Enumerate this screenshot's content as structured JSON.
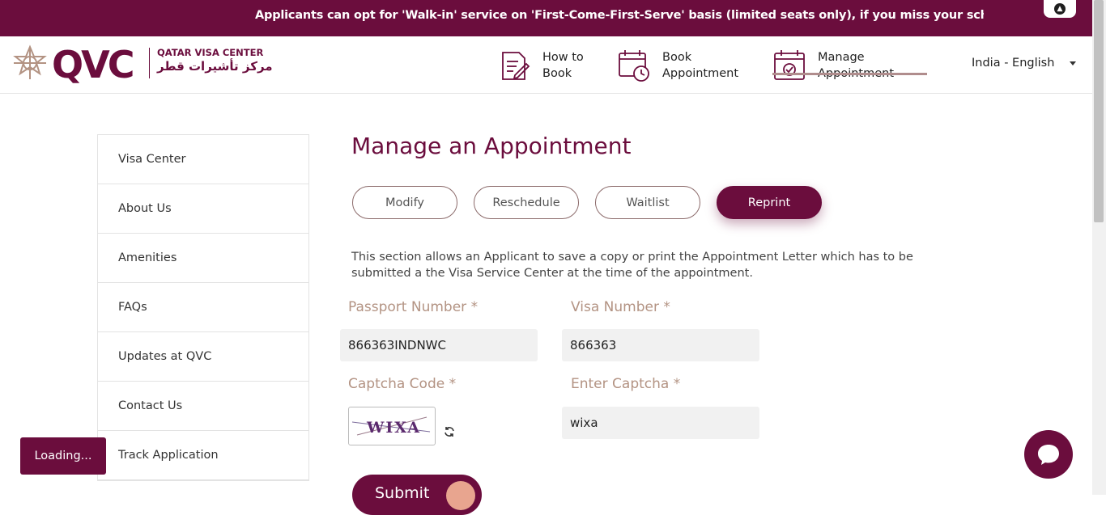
{
  "ticker": {
    "text": "Applicants can opt for 'Walk-in' service on 'First-Come-First-Serve' basis (limited seats only), if you miss your scheduled appointment"
  },
  "brand": {
    "logo_text": "QVC",
    "name_en": "QATAR VISA CENTER",
    "name_ar": "مركز تأشيرات قطر",
    "color": "#6b0d3d"
  },
  "nav": {
    "items": [
      {
        "label": "How to\nBook",
        "icon": "document-pen-icon"
      },
      {
        "label": "Book\nAppointment",
        "icon": "calendar-clock-icon"
      },
      {
        "label": "Manage\nAppointment",
        "icon": "calendar-check-icon",
        "active": true
      }
    ],
    "language": "India - English"
  },
  "sidebar": {
    "items": [
      {
        "label": "Visa Center"
      },
      {
        "label": "About Us"
      },
      {
        "label": "Amenities"
      },
      {
        "label": "FAQs"
      },
      {
        "label": "Updates at QVC"
      },
      {
        "label": "Contact Us"
      },
      {
        "label": "Track Application"
      }
    ]
  },
  "main": {
    "title": "Manage an Appointment",
    "tabs": [
      {
        "label": "Modify"
      },
      {
        "label": "Reschedule"
      },
      {
        "label": "Waitlist"
      },
      {
        "label": "Reprint",
        "active": true
      }
    ],
    "description": "This section allows an Applicant to save a copy or print the Appointment Letter which has to be submitted a the Visa Service Center at the time of the appointment.",
    "form": {
      "passport_label": "Passport Number *",
      "passport_value": "866363INDNWC",
      "visa_label": "Visa Number *",
      "visa_value": "866363",
      "captcha_label": "Captcha Code *",
      "captcha_text": "WIXA",
      "enter_captcha_label": "Enter Captcha *",
      "enter_captcha_value": "wixa",
      "submit_label": "Submit"
    }
  },
  "loading": {
    "label": "Loading..."
  }
}
